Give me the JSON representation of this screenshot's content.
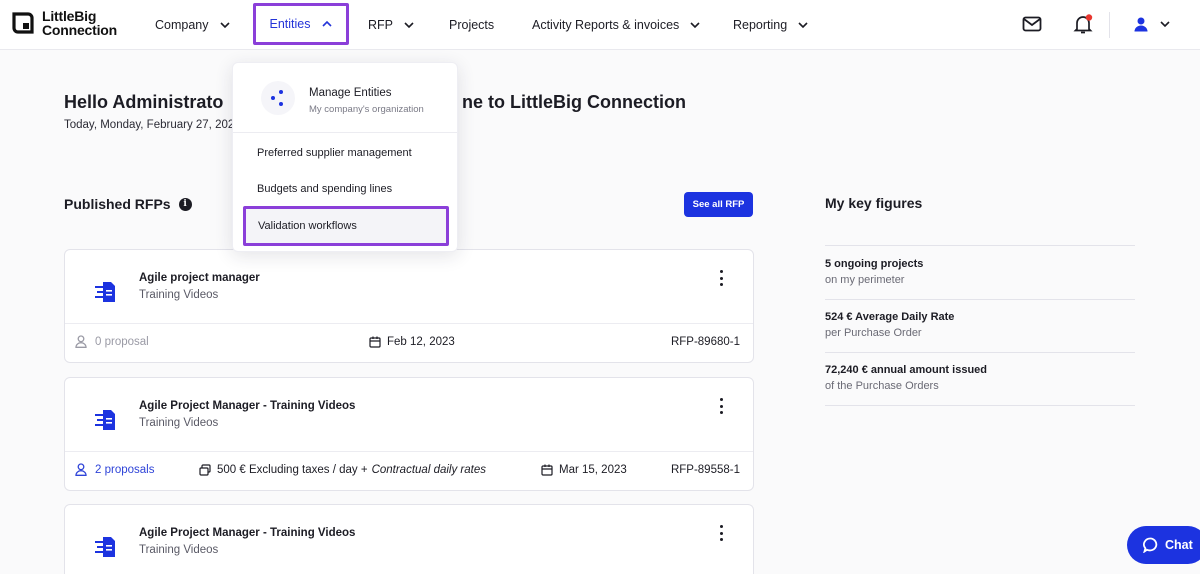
{
  "brand": {
    "line1": "LittleBig",
    "line2": "Connection"
  },
  "nav": {
    "company": "Company",
    "entities": "Entities",
    "rfp": "RFP",
    "projects": "Projects",
    "activity": "Activity Reports & invoices",
    "reporting": "Reporting"
  },
  "greeting": {
    "hello_left": "Hello Administrato",
    "hello_right": "ne to LittleBig Connection",
    "today": "Today, Monday, February 27, 202"
  },
  "dropdown": {
    "head_title": "Manage Entities",
    "head_sub": "My company's organization",
    "items": [
      "Preferred supplier management",
      "Budgets and spending lines",
      "Validation workflows"
    ]
  },
  "published": {
    "title": "Published RFPs",
    "see_all": "See all RFP",
    "cards": [
      {
        "title": "Agile project manager",
        "sub": "Training Videos",
        "proposals": "0 proposal",
        "rate": "",
        "rate_extra": "",
        "date": "Feb 12, 2023",
        "ref": "RFP-89680-1"
      },
      {
        "title": "Agile Project Manager - Training Videos",
        "sub": "Training Videos",
        "proposals": "2 proposals",
        "rate": "500 € Excluding taxes / day +",
        "rate_extra": "Contractual daily rates",
        "date": "Mar 15, 2023",
        "ref": "RFP-89558-1"
      },
      {
        "title": "Agile Project Manager - Training Videos",
        "sub": "Training Videos"
      }
    ]
  },
  "key_figures": {
    "title": "My key figures",
    "items": [
      {
        "main": "5 ongoing projects",
        "sub": "on my perimeter"
      },
      {
        "main": "524 € Average Daily Rate",
        "sub": "per Purchase Order"
      },
      {
        "main": "72,240 € annual amount issued",
        "sub": "of the Purchase Orders"
      }
    ]
  },
  "chat": {
    "label": "Chat"
  },
  "colors": {
    "accent": "#1c33e0",
    "highlight": "#8b3fd9",
    "notification": "#e8362f"
  }
}
